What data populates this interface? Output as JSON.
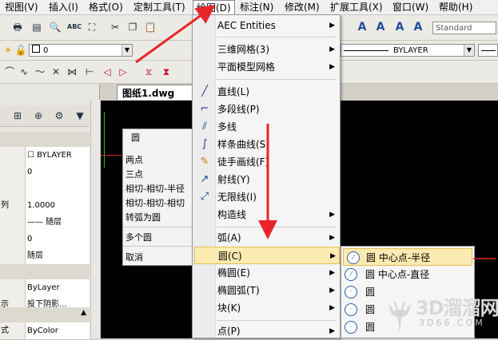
{
  "menubar": {
    "items": [
      "视图(V)",
      "插入(I)",
      "格式(O)",
      "定制工具(T)",
      "绘图(D)",
      "标注(N)",
      "修改(M)",
      "扩展工具(X)",
      "窗口(W)",
      "帮助(H)"
    ]
  },
  "toolbar": {
    "style_combo": "Standard",
    "layer_combo": "0",
    "linetype_combo": "BYLAYER"
  },
  "tab": {
    "label": "图纸1.dwg",
    "close": "×"
  },
  "properties": {
    "rows": [
      {
        "key": "",
        "value": "☐ BYLAYER"
      },
      {
        "key": "",
        "value": "0"
      },
      {
        "key": "",
        "value": ""
      },
      {
        "key": "列",
        "value": "1.0000"
      },
      {
        "key": "",
        "value": "—— 随层"
      },
      {
        "key": "",
        "value": "0"
      },
      {
        "key": "",
        "value": "随层"
      },
      {
        "key": "",
        "value": "ByLayer"
      },
      {
        "key": "示",
        "value": "投下阴影..."
      },
      {
        "key": "式",
        "value": "ByColor"
      }
    ]
  },
  "circle_flyout": {
    "title": "圆",
    "items": [
      "两点",
      "三点",
      "相切-相切-半径",
      "相切-相切-相切",
      "转弧为圆",
      "多个圆",
      "取消"
    ]
  },
  "draw_menu": {
    "items": [
      {
        "label": "AEC Entities",
        "sub": true
      },
      {
        "label": "三维网格(3)",
        "sub": true
      },
      {
        "label": "平面模型网格",
        "sub": true
      },
      {
        "label": "直线(L)",
        "sub": false,
        "icon": "line-icon"
      },
      {
        "label": "多段线(P)",
        "sub": false,
        "icon": "polyline-icon"
      },
      {
        "label": "多线",
        "sub": false,
        "icon": "multiline-icon"
      },
      {
        "label": "样条曲线(S)",
        "sub": false,
        "icon": "spline-icon"
      },
      {
        "label": "徒手画线(F)",
        "sub": false,
        "icon": "freehand-icon"
      },
      {
        "label": "射线(Y)",
        "sub": false,
        "icon": "ray-icon"
      },
      {
        "label": "无限线(I)",
        "sub": false,
        "icon": "xline-icon"
      },
      {
        "label": "构造线",
        "sub": true
      },
      {
        "label": "弧(A)",
        "sub": true
      },
      {
        "label": "圆(C)",
        "sub": true,
        "highlighted": true
      },
      {
        "label": "椭圆(E)",
        "sub": true
      },
      {
        "label": "椭圆弧(T)",
        "sub": true
      },
      {
        "label": "块(K)",
        "sub": true
      },
      {
        "label": "点(P)",
        "sub": true
      }
    ]
  },
  "circle_submenu": {
    "items": [
      {
        "label": "圆 中心点-半径",
        "highlighted": true
      },
      {
        "label": "圆 中心点-直径",
        "highlighted": false
      },
      {
        "label": "圆",
        "highlighted": false
      },
      {
        "label": "圆",
        "highlighted": false
      },
      {
        "label": "圆",
        "highlighted": false
      }
    ]
  },
  "watermark": {
    "big": "3D溜溜网",
    "small": "3D66.COM"
  },
  "colors": {
    "highlight": "#fcebb1",
    "arrow": "#e8262a",
    "canvas": "#000000"
  }
}
